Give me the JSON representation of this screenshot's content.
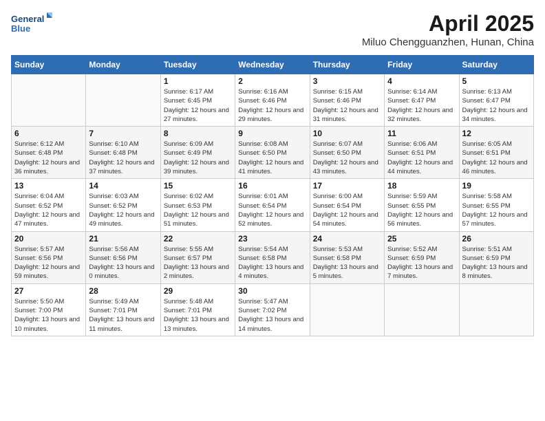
{
  "logo": {
    "line1": "General",
    "line2": "Blue"
  },
  "title": "April 2025",
  "location": "Miluo Chengguanzhen, Hunan, China",
  "weekdays": [
    "Sunday",
    "Monday",
    "Tuesday",
    "Wednesday",
    "Thursday",
    "Friday",
    "Saturday"
  ],
  "days": [
    {
      "date": "",
      "info": ""
    },
    {
      "date": "",
      "info": ""
    },
    {
      "date": "1",
      "info": "Sunrise: 6:17 AM\nSunset: 6:45 PM\nDaylight: 12 hours and 27 minutes."
    },
    {
      "date": "2",
      "info": "Sunrise: 6:16 AM\nSunset: 6:46 PM\nDaylight: 12 hours and 29 minutes."
    },
    {
      "date": "3",
      "info": "Sunrise: 6:15 AM\nSunset: 6:46 PM\nDaylight: 12 hours and 31 minutes."
    },
    {
      "date": "4",
      "info": "Sunrise: 6:14 AM\nSunset: 6:47 PM\nDaylight: 12 hours and 32 minutes."
    },
    {
      "date": "5",
      "info": "Sunrise: 6:13 AM\nSunset: 6:47 PM\nDaylight: 12 hours and 34 minutes."
    },
    {
      "date": "6",
      "info": "Sunrise: 6:12 AM\nSunset: 6:48 PM\nDaylight: 12 hours and 36 minutes."
    },
    {
      "date": "7",
      "info": "Sunrise: 6:10 AM\nSunset: 6:48 PM\nDaylight: 12 hours and 37 minutes."
    },
    {
      "date": "8",
      "info": "Sunrise: 6:09 AM\nSunset: 6:49 PM\nDaylight: 12 hours and 39 minutes."
    },
    {
      "date": "9",
      "info": "Sunrise: 6:08 AM\nSunset: 6:50 PM\nDaylight: 12 hours and 41 minutes."
    },
    {
      "date": "10",
      "info": "Sunrise: 6:07 AM\nSunset: 6:50 PM\nDaylight: 12 hours and 43 minutes."
    },
    {
      "date": "11",
      "info": "Sunrise: 6:06 AM\nSunset: 6:51 PM\nDaylight: 12 hours and 44 minutes."
    },
    {
      "date": "12",
      "info": "Sunrise: 6:05 AM\nSunset: 6:51 PM\nDaylight: 12 hours and 46 minutes."
    },
    {
      "date": "13",
      "info": "Sunrise: 6:04 AM\nSunset: 6:52 PM\nDaylight: 12 hours and 47 minutes."
    },
    {
      "date": "14",
      "info": "Sunrise: 6:03 AM\nSunset: 6:52 PM\nDaylight: 12 hours and 49 minutes."
    },
    {
      "date": "15",
      "info": "Sunrise: 6:02 AM\nSunset: 6:53 PM\nDaylight: 12 hours and 51 minutes."
    },
    {
      "date": "16",
      "info": "Sunrise: 6:01 AM\nSunset: 6:54 PM\nDaylight: 12 hours and 52 minutes."
    },
    {
      "date": "17",
      "info": "Sunrise: 6:00 AM\nSunset: 6:54 PM\nDaylight: 12 hours and 54 minutes."
    },
    {
      "date": "18",
      "info": "Sunrise: 5:59 AM\nSunset: 6:55 PM\nDaylight: 12 hours and 56 minutes."
    },
    {
      "date": "19",
      "info": "Sunrise: 5:58 AM\nSunset: 6:55 PM\nDaylight: 12 hours and 57 minutes."
    },
    {
      "date": "20",
      "info": "Sunrise: 5:57 AM\nSunset: 6:56 PM\nDaylight: 12 hours and 59 minutes."
    },
    {
      "date": "21",
      "info": "Sunrise: 5:56 AM\nSunset: 6:56 PM\nDaylight: 13 hours and 0 minutes."
    },
    {
      "date": "22",
      "info": "Sunrise: 5:55 AM\nSunset: 6:57 PM\nDaylight: 13 hours and 2 minutes."
    },
    {
      "date": "23",
      "info": "Sunrise: 5:54 AM\nSunset: 6:58 PM\nDaylight: 13 hours and 4 minutes."
    },
    {
      "date": "24",
      "info": "Sunrise: 5:53 AM\nSunset: 6:58 PM\nDaylight: 13 hours and 5 minutes."
    },
    {
      "date": "25",
      "info": "Sunrise: 5:52 AM\nSunset: 6:59 PM\nDaylight: 13 hours and 7 minutes."
    },
    {
      "date": "26",
      "info": "Sunrise: 5:51 AM\nSunset: 6:59 PM\nDaylight: 13 hours and 8 minutes."
    },
    {
      "date": "27",
      "info": "Sunrise: 5:50 AM\nSunset: 7:00 PM\nDaylight: 13 hours and 10 minutes."
    },
    {
      "date": "28",
      "info": "Sunrise: 5:49 AM\nSunset: 7:01 PM\nDaylight: 13 hours and 11 minutes."
    },
    {
      "date": "29",
      "info": "Sunrise: 5:48 AM\nSunset: 7:01 PM\nDaylight: 13 hours and 13 minutes."
    },
    {
      "date": "30",
      "info": "Sunrise: 5:47 AM\nSunset: 7:02 PM\nDaylight: 13 hours and 14 minutes."
    },
    {
      "date": "",
      "info": ""
    },
    {
      "date": "",
      "info": ""
    },
    {
      "date": "",
      "info": ""
    },
    {
      "date": "",
      "info": ""
    }
  ]
}
